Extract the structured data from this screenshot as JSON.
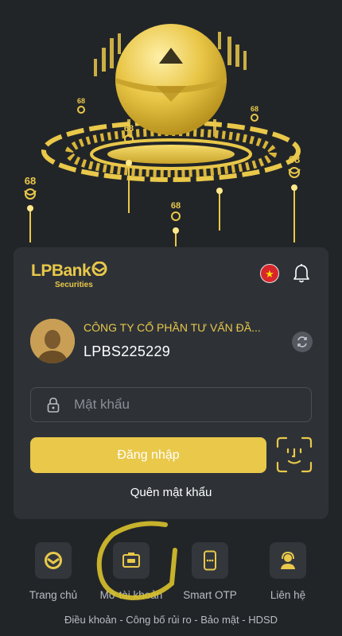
{
  "brand": {
    "name": "LPBank",
    "sub": "Securities"
  },
  "hero": {
    "coin_label": "68"
  },
  "account": {
    "company": "CÔNG TY CỔ PHẦN TƯ VẤN ĐẦ...",
    "username": "LPBS225229"
  },
  "password": {
    "placeholder": "Mật khẩu",
    "value": ""
  },
  "login": {
    "label": "Đăng nhập"
  },
  "forgot": {
    "label": "Quên mật khẩu"
  },
  "actions": [
    {
      "label": "Trang chủ",
      "icon": "home-logo-icon"
    },
    {
      "label": "Mở tài khoản",
      "icon": "open-account-icon"
    },
    {
      "label": "Smart OTP",
      "icon": "smart-otp-icon"
    },
    {
      "label": "Liên hệ",
      "icon": "contact-support-icon"
    }
  ],
  "footer": {
    "text": "Điều khoản - Công bố rủi ro - Bảo mật - HDSD"
  },
  "colors": {
    "background": "#222528",
    "card": "#2e3237",
    "accent": "#e9c84a",
    "flag": "#d7262b"
  }
}
